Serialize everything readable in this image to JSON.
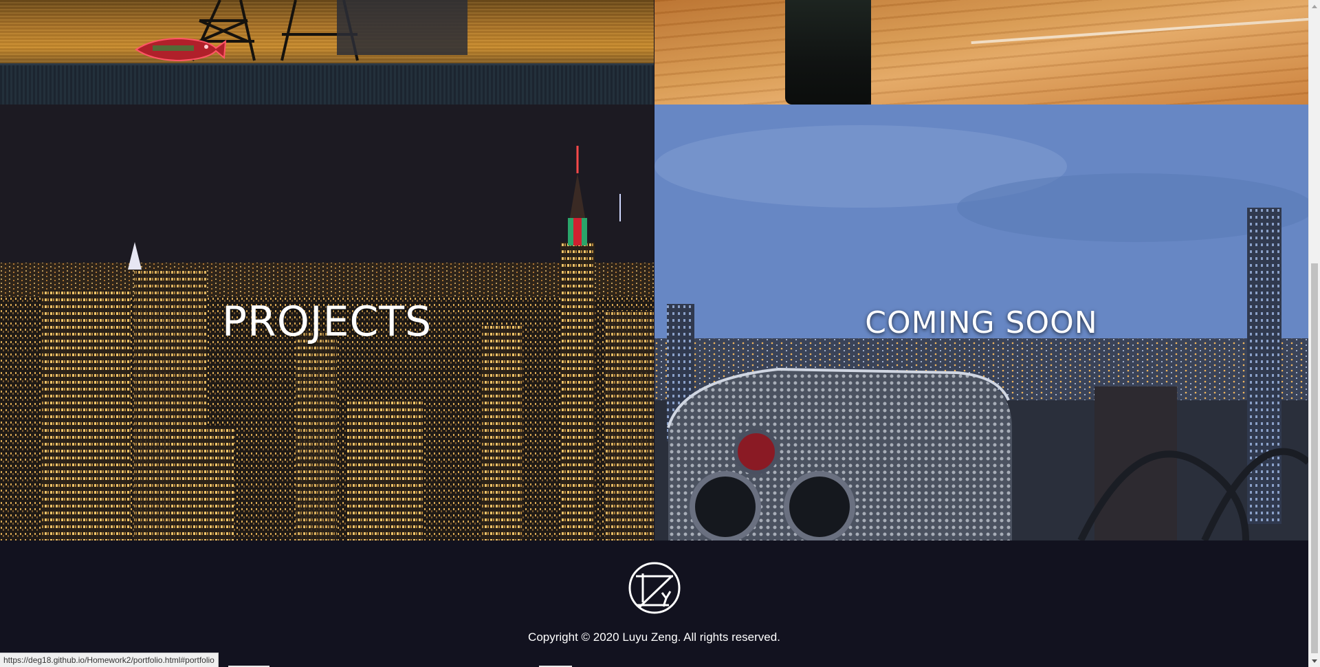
{
  "tiles": {
    "projects": {
      "label": "PROJECTS"
    },
    "coming_soon": {
      "label": "COMING SOON"
    }
  },
  "footer": {
    "copyright": "Copyright © 2020 Luyu Zeng. All rights reserved.",
    "logo_icon": "zly-monogram-logo-icon"
  },
  "statusbar": {
    "url": "https://deg18.github.io/Homework2/portfolio.html#portfolio"
  },
  "colors": {
    "footer_bg": "#12121f",
    "text": "#ffffff",
    "scrollbar_thumb": "#c1c1c1"
  }
}
